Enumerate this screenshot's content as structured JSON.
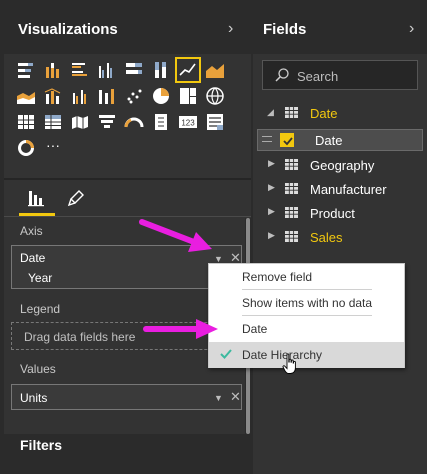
{
  "visualizations": {
    "title": "Visualizations",
    "collapse_icon": "chevron-right-icon",
    "icons": [
      [
        "stacked-bar-chart",
        "stacked-column-chart",
        "clustered-bar-chart",
        "clustered-column-chart",
        "100-stacked-bar-chart",
        "100-stacked-column-chart",
        "line-chart",
        "area-chart"
      ],
      [
        "stacked-area-chart",
        "line-and-stacked-column-chart",
        "line-and-clustered-column-chart",
        "ribbon-chart",
        "scatter-chart",
        "pie-chart",
        "treemap",
        "map"
      ],
      [
        "table",
        "matrix",
        "filled-map",
        "funnel",
        "gauge",
        "slicer",
        "card",
        "multi-row-card"
      ],
      [
        "donut-chart",
        "more-visuals"
      ]
    ],
    "selected_icon": "line-chart",
    "more_label": "···",
    "tabs": [
      {
        "name": "fields-tab",
        "icon": "bar-chart-icon",
        "active": true
      },
      {
        "name": "format-tab",
        "icon": "paint-roller-icon",
        "active": false
      }
    ],
    "axis": {
      "label": "Axis",
      "field": "Date",
      "child": "Year"
    },
    "legend": {
      "label": "Legend",
      "placeholder": "Drag data fields here"
    },
    "values": {
      "label": "Values",
      "field": "Units"
    },
    "filters_title": "Filters"
  },
  "fields": {
    "title": "Fields",
    "collapse_icon": "chevron-right-icon",
    "search_placeholder": "Search",
    "tree": [
      {
        "label": "Date",
        "expanded": true,
        "highlight": true
      },
      {
        "label": "Date",
        "is_field": true,
        "checked": true
      },
      {
        "label": "Geography",
        "expanded": false,
        "highlight": false
      },
      {
        "label": "Manufacturer",
        "expanded": false,
        "highlight": false
      },
      {
        "label": "Product",
        "expanded": false,
        "highlight": false
      },
      {
        "label": "Sales",
        "expanded": false,
        "highlight": true
      }
    ]
  },
  "context_menu": {
    "items": [
      {
        "label": "Remove field",
        "checked": false,
        "hover": false
      },
      {
        "label": "Show items with no data",
        "checked": false,
        "hover": false
      },
      {
        "label": "Date",
        "checked": false,
        "hover": false
      },
      {
        "label": "Date Hierarchy",
        "checked": true,
        "hover": true
      }
    ]
  },
  "colors": {
    "accent": "#f2c80f",
    "annotation_arrow": "#e91ee0",
    "check": "#3cba9f",
    "pane_bg": "#333333",
    "header_bg": "#2b2b2b"
  }
}
